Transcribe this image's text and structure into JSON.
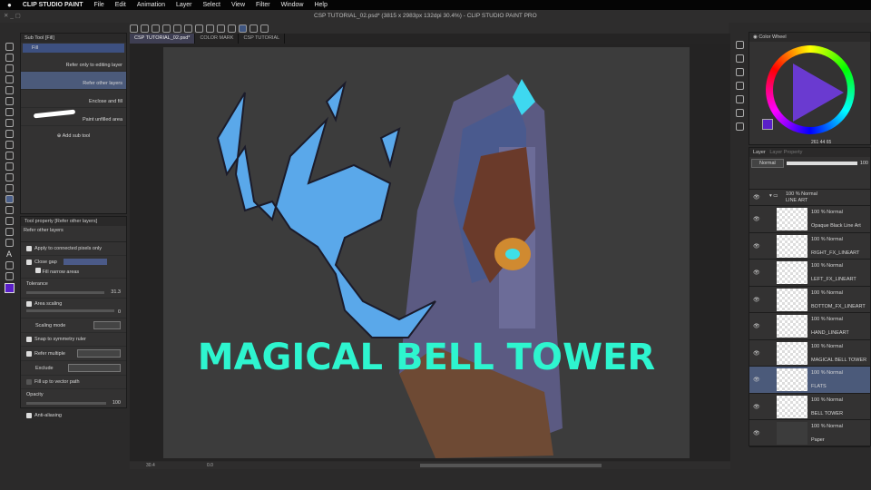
{
  "menubar": {
    "apple": "",
    "app": "CLIP STUDIO PAINT",
    "items": [
      "File",
      "Edit",
      "Animation",
      "Layer",
      "Select",
      "View",
      "Filter",
      "Window",
      "Help"
    ]
  },
  "window": {
    "title": "CSP TUTORIAL_02.psd* (3815 x 2983px 132dpi 30.4%) - CLIP STUDIO PAINT PRO"
  },
  "tabs": [
    "CSP TUTORIAL_02.psd*",
    "COLOR MARK",
    "CSP TUTORIAL"
  ],
  "subtool": {
    "header": "Sub Tool [Fill]",
    "group": "Fill",
    "items": [
      "Refer only to editing layer",
      "Refer other layers",
      "Enclose and fill",
      "Paint unfilled area"
    ],
    "selected": 1,
    "add": "Add sub tool"
  },
  "toolprop": {
    "header": "Tool property [Refer other layers]",
    "name": "Refer other layers",
    "apply_connected": "Apply to connected pixels only",
    "close_gap": "Close gap",
    "fill_narrow": "Fill narrow areas",
    "tolerance": "Tolerance",
    "tolerance_value": "31.3",
    "area_scaling": "Area scaling",
    "area_scaling_value": "0",
    "scaling_mode": "Scaling mode",
    "snap": "Snap to symmetry ruler",
    "refer_multiple": "Refer multiple",
    "exclude": "Exclude",
    "fill_vector": "Fill up to vector path",
    "opacity": "Opacity",
    "opacity_value": "100",
    "antialias": "Anti-aliasing"
  },
  "canvas": {
    "title_text": "MAGICAL BELL TOWER",
    "text_color": "#2ef5cf",
    "creature_color": "#5aa8ea"
  },
  "status": {
    "zoom": "30.4",
    "angle": "0.0"
  },
  "colorwheel": {
    "header": "Color Wheel",
    "main_color": "#5a1fc8",
    "h": "261",
    "s": "44",
    "v": "65"
  },
  "layers": {
    "tab": "Layer",
    "tab2": "Layer Property",
    "blend": "Normal",
    "opacity": "100",
    "items": [
      {
        "mode": "100 % Normal",
        "name": "LINE ART",
        "folder": true
      },
      {
        "mode": "100 % Normal",
        "name": "Opaque Black Line Art"
      },
      {
        "mode": "100 % Normal",
        "name": "RIGHT_FX_LINEART"
      },
      {
        "mode": "100 % Normal",
        "name": "LEFT_FX_LINEART"
      },
      {
        "mode": "100 % Normal",
        "name": "BOTTOM_FX_LINEART"
      },
      {
        "mode": "100 % Normal",
        "name": "HAND_LINEART"
      },
      {
        "mode": "100 % Normal",
        "name": "MAGICAL BELL TOWER"
      },
      {
        "mode": "100 % Normal",
        "name": "FLATS",
        "selected": true
      },
      {
        "mode": "100 % Normal",
        "name": "BELL TOWER"
      },
      {
        "mode": "100 % Normal",
        "name": "Paper"
      }
    ]
  }
}
